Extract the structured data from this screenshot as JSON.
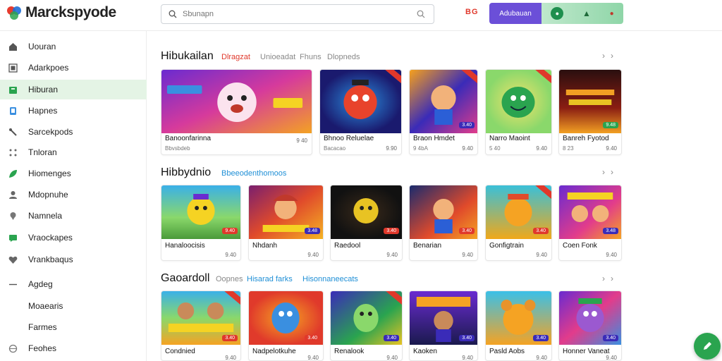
{
  "header": {
    "logo_text": "Marckspyode",
    "search_placeholder": "Sbunapn",
    "flag_text": "BG",
    "account_label": "Adubauan"
  },
  "sidebar": {
    "items": [
      {
        "label": "Uouran",
        "icon": "home-icon",
        "active": false
      },
      {
        "label": "Adarkpoes",
        "icon": "grid-icon",
        "active": false
      },
      {
        "label": "Hiburan",
        "icon": "gamepad-icon",
        "active": true
      },
      {
        "label": "Hapnes",
        "icon": "phone-icon",
        "active": false
      },
      {
        "label": "Sarcekpods",
        "icon": "wrench-icon",
        "active": false
      },
      {
        "label": "Tnloran",
        "icon": "apps-icon",
        "active": false
      },
      {
        "label": "Hiomenges",
        "icon": "leaf-icon",
        "active": false
      },
      {
        "label": "Mdopnuhe",
        "icon": "person-icon",
        "active": false
      },
      {
        "label": "Namnela",
        "icon": "pin-icon",
        "active": false
      },
      {
        "label": "Vraockapes",
        "icon": "chat-icon",
        "active": false
      },
      {
        "label": "Vrankbaqus",
        "icon": "heart-icon",
        "active": false
      },
      {
        "label": "Agdeg",
        "icon": "dash-icon",
        "active": false
      },
      {
        "label": "Moaearis",
        "icon": "",
        "active": false
      },
      {
        "label": "Farmes",
        "icon": "",
        "active": false
      },
      {
        "label": "Feohes",
        "icon": "globe-icon",
        "active": false
      }
    ]
  },
  "sections": [
    {
      "title": "Hibukailan",
      "tags": [
        "Dlragzat",
        "Unioeadat",
        "Fhuns",
        "Dlopneds"
      ],
      "cards": [
        {
          "title": "Banoonfarinna",
          "meta": "Bbvsbdeb",
          "price": "9 40",
          "badge": "",
          "art": [
            "#6a2bd0",
            "#d63a9c",
            "#f3a223"
          ]
        },
        {
          "title": "Bhnoo Reluelae",
          "meta": "Bacacao",
          "price": "9.90",
          "badge": "",
          "art": [
            "#1a1a6e",
            "#2b8fe0",
            "#f04c23"
          ]
        },
        {
          "title": "Braon Hmdet",
          "meta": "9 4bA",
          "price": "9.40",
          "badge": "3.40",
          "art": [
            "#f6a01c",
            "#3a2bb8",
            "#e23c8b"
          ]
        },
        {
          "title": "Narro Maoint",
          "meta": "5 40",
          "price": "9.40",
          "badge": "",
          "art": [
            "#8ad86b",
            "#2aa44f",
            "#f2e36b"
          ]
        },
        {
          "title": "Banreh Fyotod",
          "meta": "8 23",
          "price": "9.40",
          "badge": "9.48",
          "art": [
            "#2a0f0f",
            "#8a1d12",
            "#f2a023"
          ]
        }
      ]
    },
    {
      "title": "Hibbydnio",
      "tags": [
        "Bbeeodenthomoos"
      ],
      "cards": [
        {
          "title": "Hanaloocisis",
          "meta": "",
          "price": "9.40",
          "badge": "9.40",
          "art": [
            "#3ab0e8",
            "#8ad86b",
            "#f5d323"
          ]
        },
        {
          "title": "Nhdanh",
          "meta": "",
          "price": "9.40",
          "badge": "3.48",
          "art": [
            "#7a1f6e",
            "#e04a2b",
            "#f5b323"
          ]
        },
        {
          "title": "Raedool",
          "meta": "",
          "price": "9.40",
          "badge": "3.40",
          "art": [
            "#111111",
            "#3a2a1a",
            "#e8c323"
          ]
        },
        {
          "title": "Benarian",
          "meta": "",
          "price": "9.40",
          "badge": "3.40",
          "art": [
            "#1a2b6e",
            "#e04a2b",
            "#f5a323"
          ]
        },
        {
          "title": "Gonfigtrain",
          "meta": "",
          "price": "9.40",
          "badge": "3.40",
          "art": [
            "#3ac0d8",
            "#f0a81a",
            "#e04a2b"
          ]
        },
        {
          "title": "Coen Fonk",
          "meta": "",
          "price": "9.40",
          "badge": "3.48",
          "art": [
            "#6a2bd0",
            "#e23c8b",
            "#f5a323"
          ]
        }
      ]
    },
    {
      "title": "Gaoardoll",
      "tags": [
        "Oopnes",
        "Hisarad farks",
        "Hisonnaneecats"
      ],
      "cards": [
        {
          "title": "Condnied",
          "meta": "",
          "price": "9.40",
          "badge": "3.40",
          "art": [
            "#3ab0e8",
            "#8ad86b",
            "#f5a323"
          ]
        },
        {
          "title": "Nadpelotkuhe",
          "meta": "",
          "price": "9.40",
          "badge": "3.40",
          "art": [
            "#e03a2b",
            "#f5a323",
            "#3a8fe0"
          ]
        },
        {
          "title": "Renalook",
          "meta": "",
          "price": "9.40",
          "badge": "3.40",
          "art": [
            "#3a2bb8",
            "#2aa44f",
            "#e8c323"
          ]
        },
        {
          "title": "Kaoken",
          "meta": "",
          "price": "9.40",
          "badge": "3.40",
          "art": [
            "#1a1a4e",
            "#6a2bd0",
            "#f5a323"
          ]
        },
        {
          "title": "Pasld Aobs",
          "meta": "",
          "price": "9.40",
          "badge": "3.40",
          "art": [
            "#3ac0e8",
            "#f5a323",
            "#e04a2b"
          ]
        },
        {
          "title": "Honner Vaneat",
          "meta": "",
          "price": "9.40",
          "badge": "3.40",
          "art": [
            "#6a2bd0",
            "#e23c8b",
            "#3a8fe0"
          ]
        }
      ]
    }
  ]
}
